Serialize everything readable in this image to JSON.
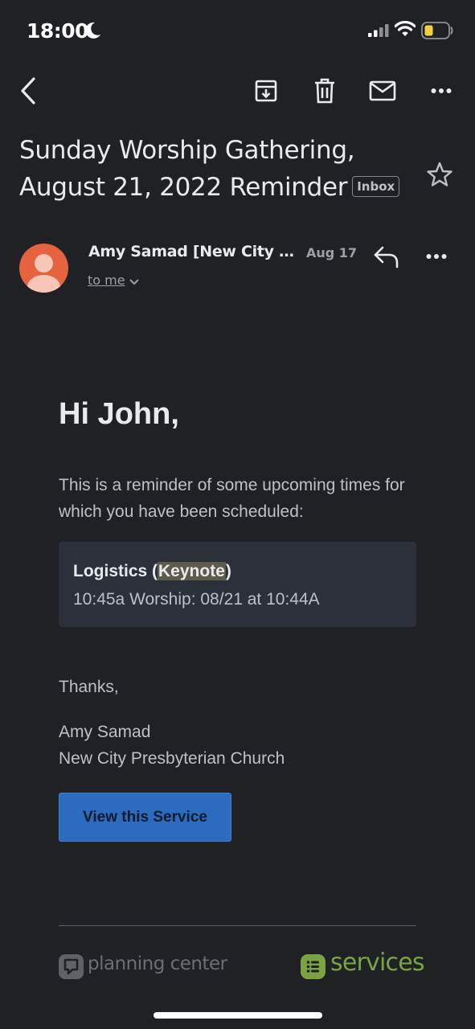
{
  "status_bar": {
    "time": "18:00",
    "icons": [
      "moon-icon",
      "signal-icon",
      "wifi-icon",
      "battery-icon"
    ],
    "battery_color": "#f4d03f"
  },
  "toolbar": {
    "icons": [
      "back-icon",
      "archive-icon",
      "delete-icon",
      "mail-icon",
      "more-icon"
    ]
  },
  "email": {
    "subject": "Sunday Worship Gathering, August 21, 2022 Reminder",
    "label": "Inbox",
    "sender": "Amy Samad [New City Pr...",
    "date": "Aug 17",
    "recipient": "to me",
    "avatar_color": "#e5643f"
  },
  "body": {
    "greeting": "Hi John,",
    "intro": "This is a reminder of some upcoming times for which you have been scheduled:",
    "schedule": {
      "title_prefix": "Logistics (",
      "title_keyword": "Keynote",
      "title_suffix": ")",
      "time": "10:45a Worship: 08/21 at 10:44A"
    },
    "thanks": "Thanks,",
    "signature_name": "Amy Samad",
    "signature_org": "New City Presbyterian Church",
    "button_label": "View this Service",
    "button_color": "#2b6cbe"
  },
  "footer": {
    "left_brand": "planning center",
    "right_brand": "services",
    "services_color": "#7aa442"
  }
}
